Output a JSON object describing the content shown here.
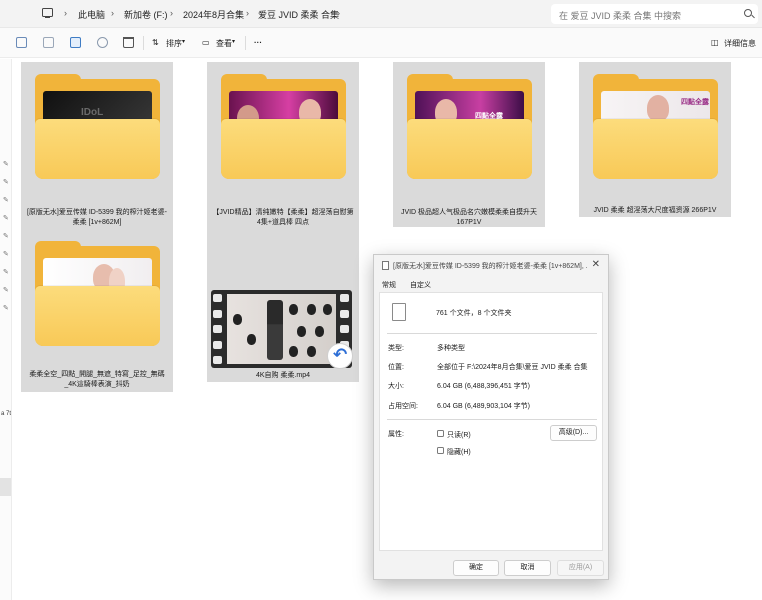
{
  "address_bar": {
    "breadcrumbs": [
      "此电脑",
      "新加卷 (F:)",
      "2024年8月合集",
      "爱豆 JVID 柔柔 合集"
    ],
    "search_placeholder": "在 爱豆 JVID 柔柔 合集 中搜索"
  },
  "toolbar": {
    "sort_label": "排序",
    "view_label": "查看",
    "more_label": "···",
    "details_label": "详细信息"
  },
  "nav": {
    "partial_text": "a 7t"
  },
  "files": [
    {
      "name": "[原版无水]爱豆传媒 ID-5399 我的榨汁姬老婆-柔柔 [1v+862M]",
      "thumb_text": "IDoL"
    },
    {
      "name": "【JVID精品】清纯嫩特【柔柔】超淫荡自慰第4集+道具棒 四点",
      "thumb_text": ""
    },
    {
      "name": "JVID 极品超人气极品名穴嫩模柔柔自摸升天 167P1V",
      "thumb_text": "四點全露"
    },
    {
      "name": "JVID 柔柔 超淫荡大尺度福资源 266P1V",
      "thumb_text": "四點全露"
    },
    {
      "name": "柔柔全空_四點_開腿_無遮_特寫_足控_無碼_4K這騎棒表演_抖奶",
      "thumb_text": ""
    },
    {
      "name": "4K自购 柔柔.mp4",
      "thumb_text": ""
    }
  ],
  "dialog": {
    "title": "[原版无水]爱豆传媒 ID-5399 我的榨汁姬老婆-柔柔 [1v+862M], ...",
    "tabs": [
      "常规",
      "自定义"
    ],
    "summary": "761 个文件，8 个文件夹",
    "props": [
      {
        "label": "类型:",
        "value": "多种类型"
      },
      {
        "label": "位置:",
        "value": "全部位于 F:\\2024年8月合集\\爱豆 JVID 柔柔 合集"
      },
      {
        "label": "大小:",
        "value": "6.04 GB (6,488,396,451 字节)"
      },
      {
        "label": "占用空间:",
        "value": "6.04 GB (6,489,903,104 字节)"
      }
    ],
    "attributes_label": "属性:",
    "readonly_label": "只读(R)",
    "hidden_label": "隐藏(H)",
    "advanced_button": "高级(D)...",
    "ok_button": "确定",
    "cancel_button": "取消",
    "apply_button": "应用(A)"
  }
}
